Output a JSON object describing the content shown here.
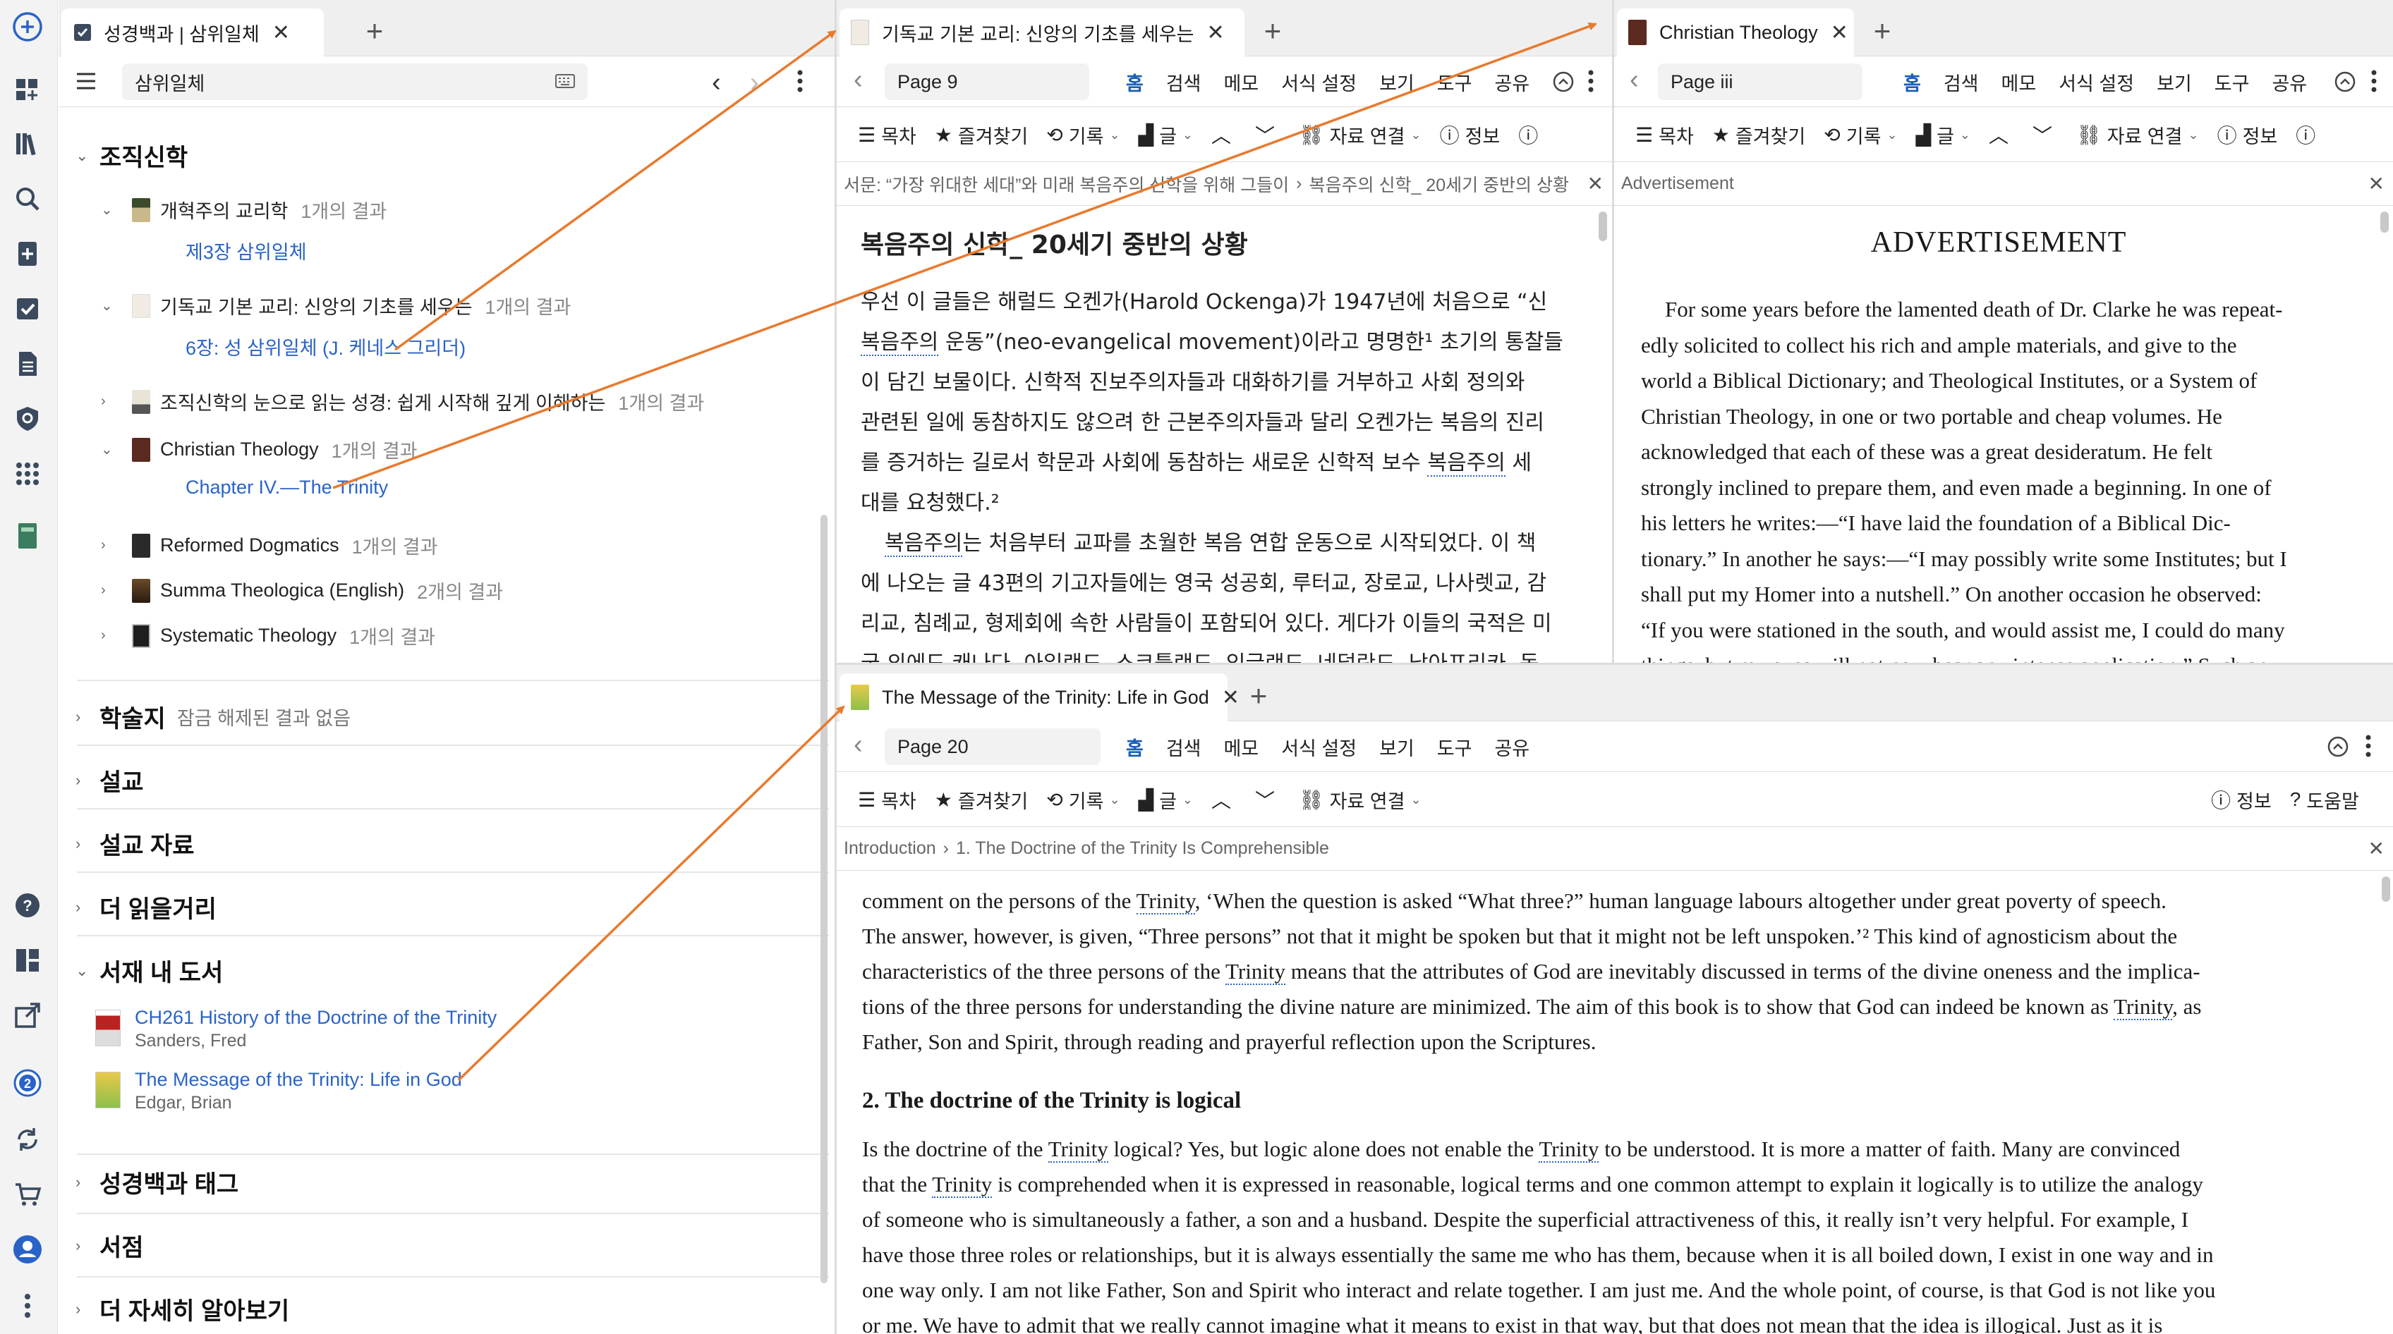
{
  "left_panel": {
    "tab_title": "성경백과 | 삼위일체",
    "search_value": "삼위일체",
    "sections": {
      "systematic": "조직신학",
      "journals": "학술지",
      "journals_note": "잠금 해제된 결과 없음",
      "sermons": "설교",
      "sermon_materials": "설교 자료",
      "more_reading": "더 읽을거리",
      "in_library": "서재 내 도서",
      "bible_tags": "성경백과 태그",
      "store": "서점",
      "learn_more": "더 자세히 알아보기"
    },
    "systematic_items": [
      {
        "title": "개혁주의 교리학",
        "count": "1개의 결과",
        "link": "제3장 삼위일체"
      },
      {
        "title": "기독교 기본 교리: 신앙의 기초를 세우는",
        "count": "1개의 결과",
        "link": "6장: 성 삼위일체 (J. 케네스 그리더)"
      },
      {
        "title": "조직신학의 눈으로 읽는 성경: 쉽게 시작해 깊게 이해하는",
        "count": "1개의 결과"
      },
      {
        "title": "Christian Theology",
        "count": "1개의 결과",
        "link": "Chapter IV.—The Trinity"
      },
      {
        "title": "Reformed Dogmatics",
        "count": "1개의 결과"
      },
      {
        "title": "Summa Theologica (English)",
        "count": "2개의 결과"
      },
      {
        "title": "Systematic Theology",
        "count": "1개의 결과"
      }
    ],
    "library_items": [
      {
        "title": "CH261 History of the Doctrine of the Trinity",
        "author": "Sanders, Fred"
      },
      {
        "title": "The Message of the Trinity: Life in God",
        "author": "Edgar, Brian"
      }
    ]
  },
  "menus": {
    "home": "홈",
    "search": "검색",
    "notes": "메모",
    "format": "서식 설정",
    "view": "보기",
    "tools": "도구",
    "share": "공유"
  },
  "toolbar": {
    "toc": "목차",
    "favorites": "즐겨찾기",
    "history": "기록",
    "text": "글",
    "links": "자료 연결",
    "info": "정보",
    "help": "도움말"
  },
  "pane_korean": {
    "tab_title": "기독교 기본 교리: 신앙의 기초를 세우는",
    "page": "Page 9",
    "breadcrumb": "서문: “가장 위대한 세대”와 미래 복음주의 신학을 위해 그들이",
    "breadcrumb2": "복음주의 신학_ 20세기 중반의 상황",
    "heading": "복음주의 신학_ 20세기 중반의 상황",
    "para1": [
      "우선 이 글들은 해럴드 오켄가(Harold Ockenga)가 1947년에 처음으로 “신",
      "복음주의 운동”(neo-evangelical movement)이라고 명명한¹ 초기의 통찰들",
      "이 담긴 보물이다. 신학적 진보주의자들과 대화하기를 거부하고 사회 정의와",
      "관련된 일에 동참하지도 않으려 한 근본주의자들과 달리 오켄가는 복음의 진리",
      "를 증거하는 길로서 학문과 사회에 동참하는 새로운 신학적 보수 복음주의 세",
      "대를 요청했다.²"
    ],
    "para2": [
      "복음주의는 처음부터 교파를 초월한 복음 연합 운동으로 시작되었다. 이 책",
      "에 나오는 글 43편의 기고자들에는 영국 성공회, 루터교, 장로교, 나사렛교, 감",
      "리교, 침례교, 형제회에 속한 사람들이 포함되어 있다. 게다가 이들의 국적은 미",
      "국 외에도 캐나다, 아일랜드, 스코틀랜드, 잉글랜드, 네덜란드, 남아프리카, 독"
    ]
  },
  "pane_ct": {
    "tab_title": "Christian Theology",
    "page": "Page iii",
    "breadcrumb": "Advertisement",
    "heading": "ADVERTISEMENT",
    "lines": [
      "For some years before the lamented death of Dr. Clarke he was repeat-",
      "edly solicited to collect his rich and ample materials, and give to the",
      "world a Biblical Dictionary; and Theological Institutes, or a System of",
      "Christian Theology, in one or two portable and cheap volumes. He",
      "acknowledged that each of these was a great desideratum. He felt",
      "strongly inclined to prepare them, and even made a beginning. In one of",
      "his letters he writes:—“I have laid the foundation of a Biblical Dic-",
      "tionary.” In another he says:—“I may possibly write some Institutes; but I",
      "shall put my Homer into a nutshell.” On another occasion he observed:",
      "“If you were stationed in the south, and would assist me, I could do many",
      "things, but my eyes will not now bear any intense application.” Such an"
    ]
  },
  "pane_msg": {
    "tab_title": "The Message of the Trinity: Life in God",
    "page": "Page 20",
    "breadcrumb": "Introduction",
    "breadcrumb2": "1. The Doctrine of the Trinity Is Comprehensible",
    "lines1": [
      "comment on the persons of the Trinity, ‘When the question is asked “What three?” human language labours altogether under great poverty of speech.",
      "The answer, however, is given, “Three persons” not that it might be spoken but that it might not be left unspoken.’² This kind of agnosticism about the",
      "characteristics of the three persons of the Trinity means that the attributes of God are inevitably discussed in terms of the divine oneness and the implica-",
      "tions of the three persons for understanding the divine nature are minimized. The aim of this book is to show that God can indeed be known as Trinity, as",
      "Father, Son and Spirit, through reading and prayerful reflection upon the Scriptures."
    ],
    "subheading": "2. The doctrine of the Trinity is logical",
    "lines2": [
      "Is the doctrine of the Trinity logical? Yes, but logic alone does not enable the Trinity to be understood. It is more a matter of faith. Many are convinced",
      "that the Trinity is comprehended when it is expressed in reasonable, logical terms and one common attempt to explain it logically is to utilize the analogy",
      "of someone who is simultaneously a father, a son and a husband. Despite the superficial attractiveness of this, it really isn’t very helpful. For example, I",
      "have those three roles or relationships, but it is always essentially the same me who has them, because when it is all boiled down, I exist in one way and in",
      "one way only. I am not like Father, Son and Spirit who interact and relate together. I am just me. And the whole point, of course, is that God is not like you",
      "or me. We have to admit that we really cannot imagine what it means to exist in that way, but that does not mean that the idea is illogical. Just as it is"
    ]
  },
  "colors": {
    "accent": "#1a5fb4",
    "link": "#2a63c7",
    "arrow": "#e87a2e"
  }
}
